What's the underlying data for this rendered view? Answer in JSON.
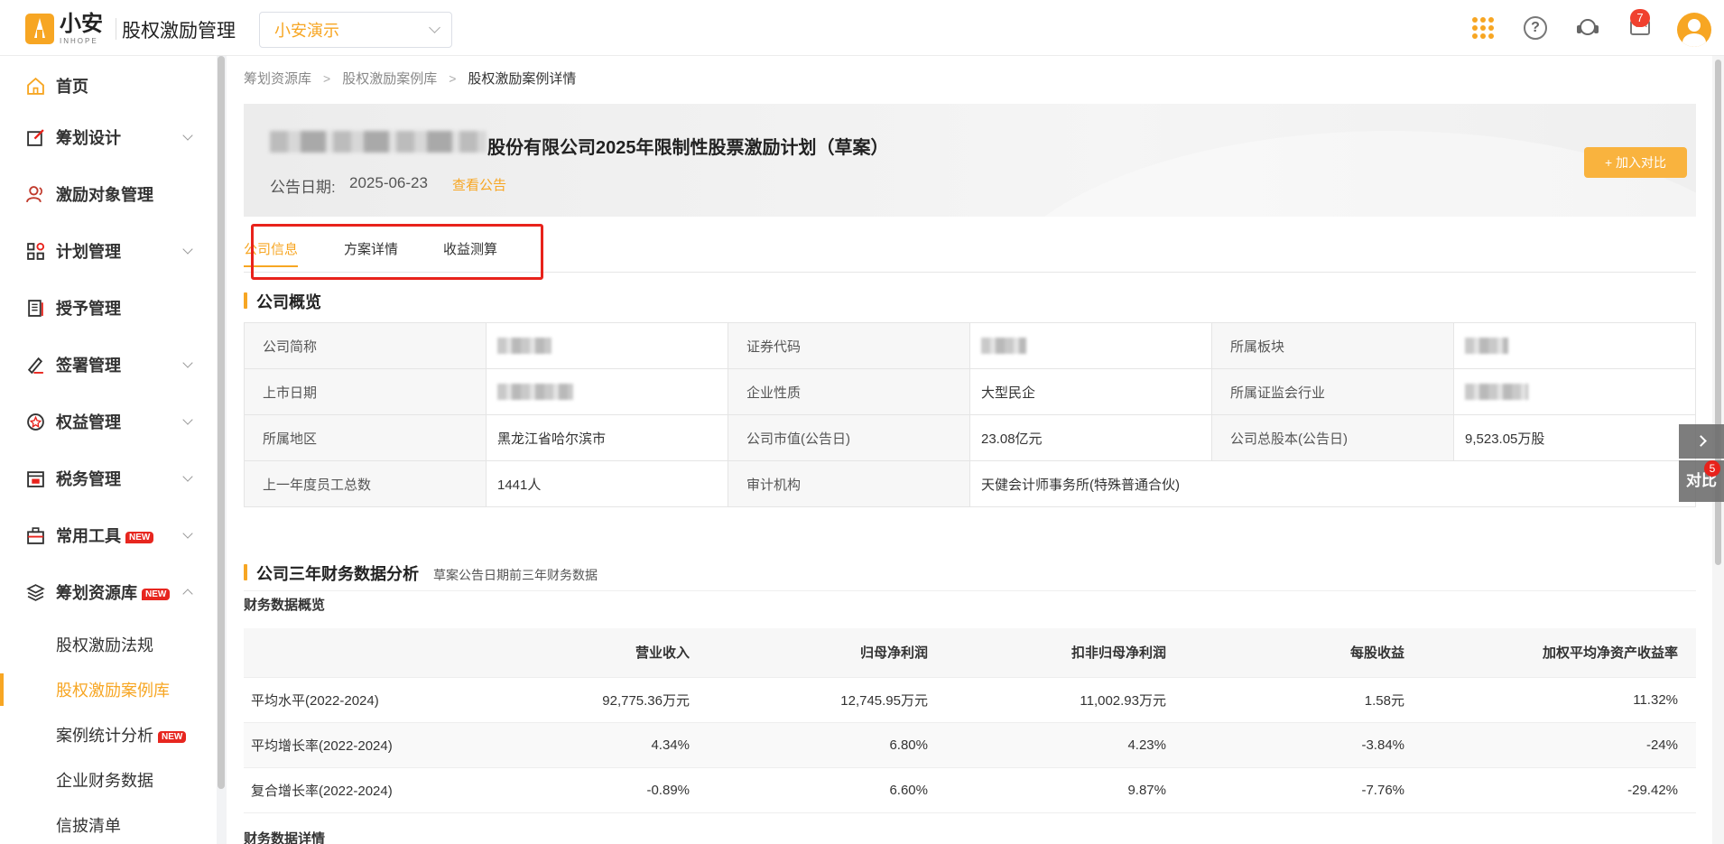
{
  "header": {
    "logo_text": "小安",
    "logo_sub": "INHOPE",
    "app_title": "股权激励管理",
    "org_select_value": "小安演示",
    "message_count": "7"
  },
  "sidebar": {
    "items": [
      {
        "label": "首页",
        "icon": "home-icon"
      },
      {
        "label": "筹划设计",
        "icon": "edit-icon"
      },
      {
        "label": "激励对象管理",
        "icon": "users-icon"
      },
      {
        "label": "计划管理",
        "icon": "apps-icon"
      },
      {
        "label": "授予管理",
        "icon": "document-icon"
      },
      {
        "label": "签署管理",
        "icon": "sign-icon"
      },
      {
        "label": "权益管理",
        "icon": "badge-icon"
      },
      {
        "label": "税务管理",
        "icon": "tax-icon"
      },
      {
        "label": "常用工具",
        "icon": "toolbox-icon",
        "badge": "NEW"
      },
      {
        "label": "筹划资源库",
        "icon": "layers-icon",
        "badge": "NEW"
      }
    ],
    "sub_items": [
      {
        "label": "股权激励法规"
      },
      {
        "label": "股权激励案例库"
      },
      {
        "label": "案例统计分析",
        "badge": "NEW"
      },
      {
        "label": "企业财务数据"
      },
      {
        "label": "信披清单"
      }
    ]
  },
  "breadcrumb": [
    "筹划资源库",
    "股权激励案例库",
    "股权激励案例详情"
  ],
  "banner": {
    "title": "股份有限公司2025年限制性股票激励计划（草案）",
    "date_label": "公告日期:",
    "date": "2025-06-23",
    "view_link": "查看公告",
    "compare_button": "+ 加入对比"
  },
  "tabs": [
    "公司信息",
    "方案详情",
    "收益测算"
  ],
  "overview": {
    "title": "公司概览",
    "labels": {
      "short_name": "公司简称",
      "code": "证券代码",
      "board": "所属板块",
      "listing_date": "上市日期",
      "nature": "企业性质",
      "csrc_industry": "所属证监会行业",
      "region": "所属地区",
      "market_cap": "公司市值(公告日)",
      "total_shares": "公司总股本(公告日)",
      "employees": "上一年度员工总数",
      "auditor": "审计机构"
    },
    "values": {
      "nature": "大型民企",
      "region": "黑龙江省哈尔滨市",
      "market_cap": "23.08亿元",
      "total_shares": "9,523.05万股",
      "employees": "1441人",
      "auditor": "天健会计师事务所(特殊普通合伙)"
    }
  },
  "financial": {
    "title": "公司三年财务数据分析",
    "subtitle": "草案公告日期前三年财务数据",
    "overview_label": "财务数据概览",
    "detail_label": "财务数据详情",
    "columns": [
      "营业收入",
      "归母净利润",
      "扣非归母净利润",
      "每股收益",
      "加权平均净资产收益率"
    ],
    "rows": [
      {
        "label": "平均水平(2022-2024)",
        "values": [
          "92,775.36万元",
          "12,745.95万元",
          "11,002.93万元",
          "1.58元",
          "11.32%"
        ]
      },
      {
        "label": "平均增长率(2022-2024)",
        "values": [
          "4.34%",
          "6.80%",
          "4.23%",
          "-3.84%",
          "-24%"
        ]
      },
      {
        "label": "复合增长率(2022-2024)",
        "values": [
          "-0.89%",
          "6.60%",
          "9.87%",
          "-7.76%",
          "-29.42%"
        ]
      }
    ]
  },
  "float": {
    "compare_label": "对比",
    "compare_count": "5"
  }
}
